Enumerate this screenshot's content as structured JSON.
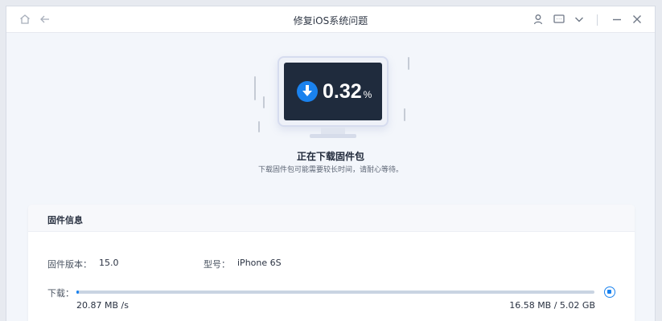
{
  "window": {
    "title": "修复iOS系统问题"
  },
  "hero": {
    "progress_value": "0.32",
    "progress_unit": "%",
    "progress_fraction": 0.0032,
    "status_title": "正在下载固件包",
    "status_subtitle": "下载固件包可能需要较长时间，请耐心等待。"
  },
  "firmware_card": {
    "header": "固件信息",
    "version_label": "固件版本：",
    "version_value": "15.0",
    "model_label": "型号：",
    "model_value": "iPhone 6S",
    "download_label": "下载：",
    "speed": "20.87 MB /s",
    "size_progress": "16.58 MB / 5.02 GB"
  },
  "colors": {
    "accent": "#1a82ee",
    "screen": "#1f2b3d",
    "track": "#c9d4e2"
  },
  "icons": [
    "home-icon",
    "back-arrow-icon",
    "user-icon",
    "feedback-icon",
    "chevron-down-icon",
    "minimize-icon",
    "close-icon",
    "download-arrow-icon",
    "stop-icon"
  ]
}
